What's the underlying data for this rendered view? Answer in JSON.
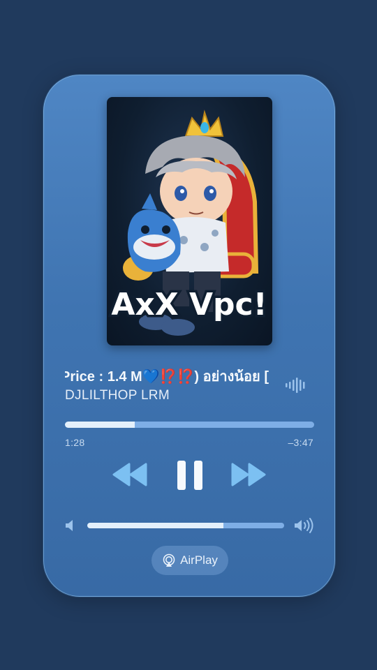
{
  "player": {
    "artwork_text": "AxX Vpc!",
    "title": "Price : 1.4 M💙⁉️⁉️) อย่างน้อย [",
    "artist": "DJLILTHOP LRM",
    "elapsed": "1:28",
    "remaining": "–3:47",
    "progress_fraction": 0.28,
    "volume_fraction": 0.69,
    "airplay_label": "AirPlay"
  },
  "icons": {
    "wave": "audio-waveform-icon",
    "rewind": "rewind-icon",
    "pause": "pause-icon",
    "forward": "fast-forward-icon",
    "volume_low": "speaker-low-icon",
    "volume_high": "speaker-high-icon",
    "airplay": "airplay-icon"
  },
  "colors": {
    "background": "#203a5d",
    "card": "#4376b3",
    "accent": "#e4f0fb",
    "control_blue": "#7cc0f2"
  }
}
